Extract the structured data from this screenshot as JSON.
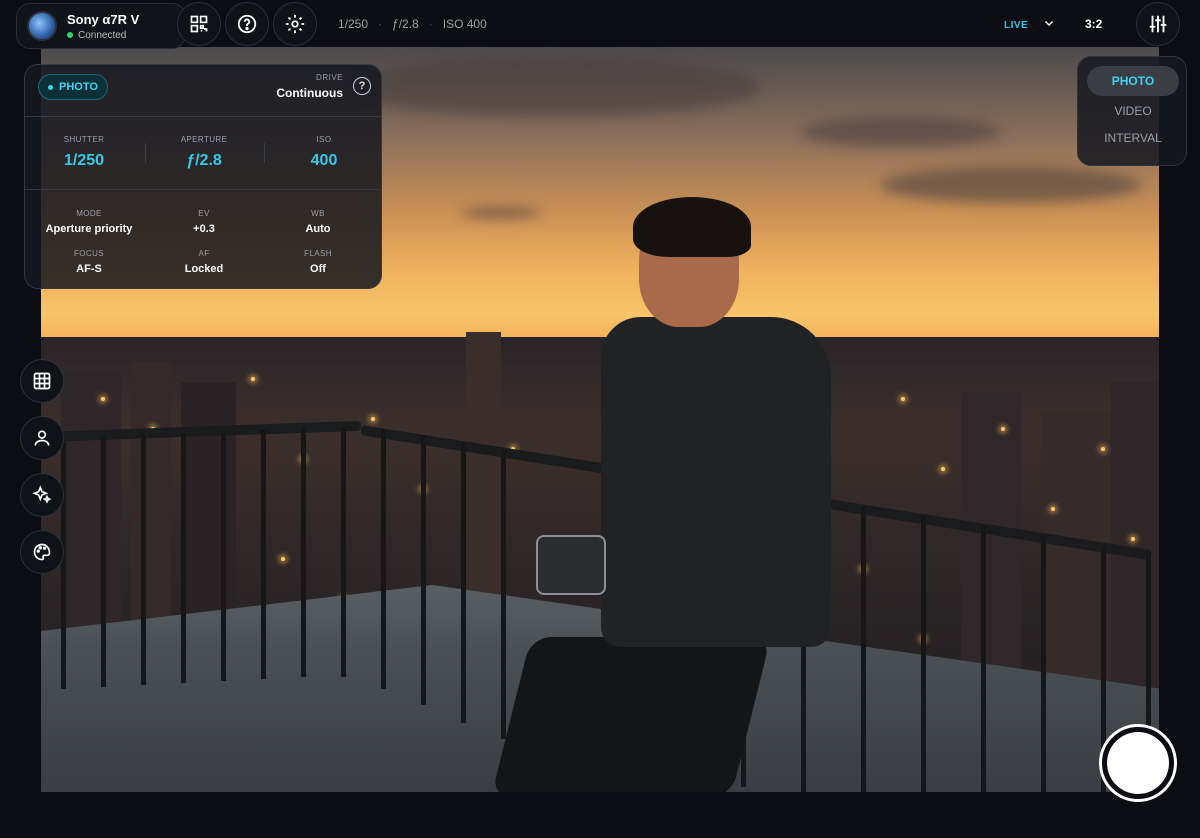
{
  "device": {
    "name": "Sony α7R V",
    "status": "Connected"
  },
  "topbar": {
    "shutter": "1/250",
    "aperture": "ƒ/2.8",
    "iso": "ISO 400",
    "separator": "·",
    "live_label": "LIVE",
    "aspect_ratio": "3:2",
    "icons": [
      "qr-code-icon",
      "help-icon",
      "settings-gear-icon",
      "sliders-icon",
      "chevron-down-icon"
    ]
  },
  "settings": {
    "mode_pill": "PHOTO",
    "drive_label": "DRIVE",
    "drive_value": "Continuous",
    "help_glyph": "?",
    "main": [
      {
        "label": "SHUTTER",
        "value": "1/250"
      },
      {
        "label": "APERTURE",
        "value": "ƒ/2.8"
      },
      {
        "label": "ISO",
        "value": "400"
      }
    ],
    "details_row1": [
      {
        "label": "MODE",
        "value": "Aperture priority"
      },
      {
        "label": "EV",
        "value": "+0.3"
      },
      {
        "label": "WB",
        "value": "Auto"
      }
    ],
    "details_row2": [
      {
        "label": "FOCUS",
        "value": "AF-S"
      },
      {
        "label": "AF",
        "value": "Locked"
      },
      {
        "label": "FLASH",
        "value": "Off"
      }
    ]
  },
  "modes": {
    "items": [
      "PHOTO",
      "VIDEO",
      "INTERVAL"
    ],
    "active": "PHOTO"
  },
  "tools": [
    "grid-icon",
    "person-icon",
    "sparkles-icon",
    "palette-icon"
  ],
  "colors": {
    "accent": "#37c8e6",
    "status_green": "#2bd66b",
    "panel_bg": "#16191f"
  }
}
